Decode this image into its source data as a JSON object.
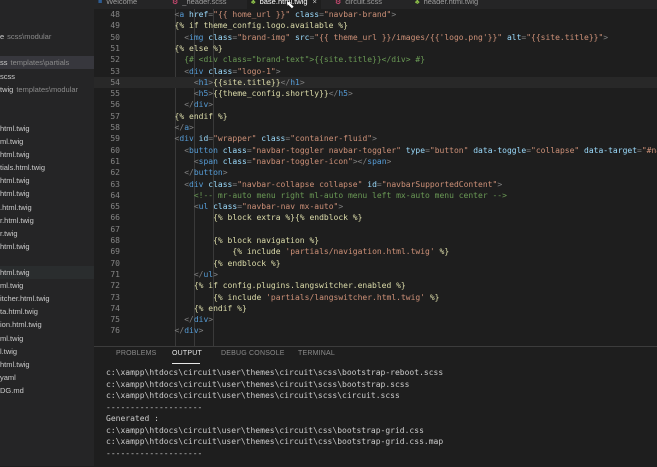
{
  "sidebar": {
    "items": [
      {
        "name": "",
        "dim": "",
        "selected": false
      },
      {
        "name": "",
        "dim": "",
        "selected": false
      },
      {
        "name": "e",
        "dim": "scss\\modular",
        "selected": false
      },
      {
        "name": "",
        "dim": "",
        "selected": false
      },
      {
        "name": "ss",
        "dim": "templates\\partials",
        "selected": true
      },
      {
        "name": "scss",
        "dim": "",
        "selected": false
      },
      {
        "name": "twig",
        "dim": "templates\\modular",
        "selected": false
      },
      {
        "name": "",
        "dim": "",
        "selected": false
      },
      {
        "name": "",
        "dim": "",
        "selected": false
      },
      {
        "name": "html.twig",
        "dim": "",
        "selected": false
      },
      {
        "name": "ml.twig",
        "dim": "",
        "selected": false
      },
      {
        "name": "html.twig",
        "dim": "",
        "selected": false
      },
      {
        "name": "tials.html.twig",
        "dim": "",
        "selected": false
      },
      {
        "name": "html.twig",
        "dim": "",
        "selected": false
      },
      {
        "name": "html.twig",
        "dim": "",
        "selected": false
      },
      {
        "name": ".html.twig",
        "dim": "",
        "selected": false
      },
      {
        "name": "r.html.twig",
        "dim": "",
        "selected": false
      },
      {
        "name": "r.twig",
        "dim": "",
        "selected": false
      },
      {
        "name": "html.twig",
        "dim": "",
        "selected": false
      },
      {
        "name": "",
        "dim": "",
        "selected": false
      },
      {
        "name": "html.twig",
        "dim": "",
        "selected": false,
        "hl": true
      },
      {
        "name": "ml.twig",
        "dim": "",
        "selected": false
      },
      {
        "name": "itcher.html.twig",
        "dim": "",
        "selected": false
      },
      {
        "name": "ta.html.twig",
        "dim": "",
        "selected": false
      },
      {
        "name": "ion.html.twig",
        "dim": "",
        "selected": false
      },
      {
        "name": "ml.twig",
        "dim": "",
        "selected": false
      },
      {
        "name": "l.twig",
        "dim": "",
        "selected": false
      },
      {
        "name": "html.twig",
        "dim": "",
        "selected": false
      },
      {
        "name": "yaml",
        "dim": "",
        "selected": false
      },
      {
        "name": "DG.md",
        "dim": "",
        "selected": false
      }
    ]
  },
  "tabs": [
    {
      "label": "Welcome",
      "icon": "≡",
      "icon_color": "#3794ff",
      "active": false
    },
    {
      "label": "_header.scss",
      "icon": "⚙",
      "icon_color": "#f55385",
      "active": false
    },
    {
      "label": "base.html.twig",
      "icon": "♣",
      "icon_color": "#8dc149",
      "active": true,
      "close": "×"
    },
    {
      "label": "circuit.scss",
      "icon": "⚙",
      "icon_color": "#f55385",
      "active": false
    },
    {
      "label": "header.html.twig",
      "icon": "♣",
      "icon_color": "#8dc149",
      "active": false
    }
  ],
  "editor": {
    "current_line": 54,
    "lines": [
      {
        "n": "48",
        "indent": 4,
        "tokens": [
          [
            "pu",
            "<"
          ],
          [
            "tg",
            "a"
          ],
          [
            "at",
            " href"
          ],
          [
            "pu",
            "="
          ],
          [
            "st",
            "\"{{ home_url }}\""
          ],
          [
            "at",
            " class"
          ],
          [
            "pu",
            "="
          ],
          [
            "st",
            "\"navbar-brand\""
          ],
          [
            "pu",
            ">"
          ]
        ]
      },
      {
        "n": "49",
        "indent": 4,
        "tokens": [
          [
            "tw",
            "{% if theme_config.logo.available %}"
          ]
        ]
      },
      {
        "n": "50",
        "indent": 5,
        "tokens": [
          [
            "pu",
            "<"
          ],
          [
            "tg",
            "img"
          ],
          [
            "at",
            " class"
          ],
          [
            "pu",
            "="
          ],
          [
            "st",
            "\"brand-img\""
          ],
          [
            "at",
            " src"
          ],
          [
            "pu",
            "="
          ],
          [
            "st",
            "\"{{ theme_url }}/images/{{'logo.png'}}\""
          ],
          [
            "at",
            " alt"
          ],
          [
            "pu",
            "="
          ],
          [
            "st",
            "\"{{site.title}}\""
          ],
          [
            "pu",
            ">"
          ]
        ]
      },
      {
        "n": "51",
        "indent": 4,
        "tokens": [
          [
            "tw",
            "{% else %}"
          ]
        ]
      },
      {
        "n": "52",
        "indent": 5,
        "tokens": [
          [
            "cm",
            "{# <div class=\"brand-text\">{{site.title}}</div> #}"
          ]
        ]
      },
      {
        "n": "53",
        "indent": 5,
        "tokens": [
          [
            "pu",
            "<"
          ],
          [
            "tg",
            "div"
          ],
          [
            "at",
            " class"
          ],
          [
            "pu",
            "="
          ],
          [
            "st",
            "\"logo-1\""
          ],
          [
            "pu",
            ">"
          ]
        ]
      },
      {
        "n": "54",
        "indent": 6,
        "tokens": [
          [
            "pu",
            "<"
          ],
          [
            "tg",
            "h1"
          ],
          [
            "pu",
            ">"
          ],
          [
            "tw",
            "{{site.title}}"
          ],
          [
            "pu",
            "</"
          ],
          [
            "tg",
            "h1"
          ],
          [
            "pu",
            ">"
          ]
        ]
      },
      {
        "n": "55",
        "indent": 6,
        "tokens": [
          [
            "pu",
            "<"
          ],
          [
            "tg",
            "h5"
          ],
          [
            "pu",
            ">"
          ],
          [
            "tw",
            "{{theme_config.shortly}}"
          ],
          [
            "pu",
            "</"
          ],
          [
            "tg",
            "h5"
          ],
          [
            "pu",
            ">"
          ]
        ]
      },
      {
        "n": "56",
        "indent": 5,
        "tokens": [
          [
            "pu",
            "</"
          ],
          [
            "tg",
            "div"
          ],
          [
            "pu",
            ">"
          ]
        ]
      },
      {
        "n": "57",
        "indent": 4,
        "tokens": [
          [
            "tw",
            "{% endif %}"
          ]
        ]
      },
      {
        "n": "58",
        "indent": 4,
        "tokens": [
          [
            "pu",
            "</"
          ],
          [
            "tg",
            "a"
          ],
          [
            "pu",
            ">"
          ]
        ]
      },
      {
        "n": "59",
        "indent": 4,
        "tokens": [
          [
            "pu",
            "<"
          ],
          [
            "tg",
            "div"
          ],
          [
            "at",
            " id"
          ],
          [
            "pu",
            "="
          ],
          [
            "st",
            "\"wrapper\""
          ],
          [
            "at",
            " class"
          ],
          [
            "pu",
            "="
          ],
          [
            "st",
            "\"container-fluid\""
          ],
          [
            "pu",
            ">"
          ]
        ]
      },
      {
        "n": "60",
        "indent": 5,
        "tokens": [
          [
            "pu",
            "<"
          ],
          [
            "tg",
            "button"
          ],
          [
            "at",
            " class"
          ],
          [
            "pu",
            "="
          ],
          [
            "st",
            "\"navbar-toggler navbar-toggler\""
          ],
          [
            "at",
            " type"
          ],
          [
            "pu",
            "="
          ],
          [
            "st",
            "\"button\""
          ],
          [
            "at",
            " data-toggle"
          ],
          [
            "pu",
            "="
          ],
          [
            "st",
            "\"collapse\""
          ],
          [
            "at",
            " data-target"
          ],
          [
            "pu",
            "="
          ],
          [
            "st",
            "\"#navbarSu"
          ]
        ]
      },
      {
        "n": "61",
        "indent": 6,
        "tokens": [
          [
            "pu",
            "<"
          ],
          [
            "tg",
            "span"
          ],
          [
            "at",
            " class"
          ],
          [
            "pu",
            "="
          ],
          [
            "st",
            "\"navbar-toggler-icon\""
          ],
          [
            "pu",
            "></"
          ],
          [
            "tg",
            "span"
          ],
          [
            "pu",
            ">"
          ]
        ]
      },
      {
        "n": "62",
        "indent": 5,
        "tokens": [
          [
            "pu",
            "</"
          ],
          [
            "tg",
            "button"
          ],
          [
            "pu",
            ">"
          ]
        ]
      },
      {
        "n": "63",
        "indent": 5,
        "tokens": [
          [
            "pu",
            "<"
          ],
          [
            "tg",
            "div"
          ],
          [
            "at",
            " class"
          ],
          [
            "pu",
            "="
          ],
          [
            "st",
            "\"navbar-collapse collapse\""
          ],
          [
            "at",
            " id"
          ],
          [
            "pu",
            "="
          ],
          [
            "st",
            "\"navbarSupportedContent\""
          ],
          [
            "pu",
            ">"
          ]
        ]
      },
      {
        "n": "64",
        "indent": 6,
        "tokens": [
          [
            "cm",
            "<!-- mr-auto menu right ml-auto menu left mx-auto menu center -->"
          ]
        ]
      },
      {
        "n": "65",
        "indent": 6,
        "tokens": [
          [
            "pu",
            "<"
          ],
          [
            "tg",
            "ul"
          ],
          [
            "at",
            " class"
          ],
          [
            "pu",
            "="
          ],
          [
            "st",
            "\"navbar-nav mx-auto\""
          ],
          [
            "pu",
            ">"
          ]
        ]
      },
      {
        "n": "66",
        "indent": 8,
        "tokens": [
          [
            "tw",
            "{% block extra %}{% endblock %}"
          ]
        ]
      },
      {
        "n": "67",
        "indent": 0,
        "tokens": []
      },
      {
        "n": "68",
        "indent": 8,
        "tokens": [
          [
            "tw",
            "{% block navigation %}"
          ]
        ]
      },
      {
        "n": "69",
        "indent": 10,
        "tokens": [
          [
            "tw",
            "{% include "
          ],
          [
            "st",
            "'partials/navigation.html.twig'"
          ],
          [
            "tw",
            " %}"
          ]
        ]
      },
      {
        "n": "70",
        "indent": 8,
        "tokens": [
          [
            "tw",
            "{% endblock %}"
          ]
        ]
      },
      {
        "n": "71",
        "indent": 6,
        "tokens": [
          [
            "pu",
            "</"
          ],
          [
            "tg",
            "ul"
          ],
          [
            "pu",
            ">"
          ]
        ]
      },
      {
        "n": "72",
        "indent": 6,
        "tokens": [
          [
            "tw",
            "{% if config.plugins.langswitcher.enabled %}"
          ]
        ]
      },
      {
        "n": "73",
        "indent": 8,
        "tokens": [
          [
            "tw",
            "{% include "
          ],
          [
            "st",
            "'partials/langswitcher.html.twig'"
          ],
          [
            "tw",
            " %}"
          ]
        ]
      },
      {
        "n": "74",
        "indent": 6,
        "tokens": [
          [
            "tw",
            "{% endif %}"
          ]
        ]
      },
      {
        "n": "75",
        "indent": 5,
        "tokens": [
          [
            "pu",
            "</"
          ],
          [
            "tg",
            "div"
          ],
          [
            "pu",
            ">"
          ]
        ]
      },
      {
        "n": "76",
        "indent": 4,
        "tokens": [
          [
            "pu",
            "</"
          ],
          [
            "tg",
            "div"
          ],
          [
            "pu",
            ">"
          ]
        ]
      }
    ]
  },
  "panel": {
    "tabs": [
      "PROBLEMS",
      "OUTPUT",
      "DEBUG CONSOLE",
      "TERMINAL"
    ],
    "active_tab": "OUTPUT",
    "output": [
      "c:\\xampp\\htdocs\\circuit\\user\\themes\\circuit\\scss\\bootstrap-reboot.scss",
      "c:\\xampp\\htdocs\\circuit\\user\\themes\\circuit\\scss\\bootstrap.scss",
      "c:\\xampp\\htdocs\\circuit\\user\\themes\\circuit\\scss\\circuit.scss",
      "--------------------",
      "Generated :",
      "c:\\xampp\\htdocs\\circuit\\user\\themes\\circuit\\css\\bootstrap-grid.css",
      "c:\\xampp\\htdocs\\circuit\\user\\themes\\circuit\\css\\bootstrap-grid.css.map",
      "--------------------"
    ]
  }
}
